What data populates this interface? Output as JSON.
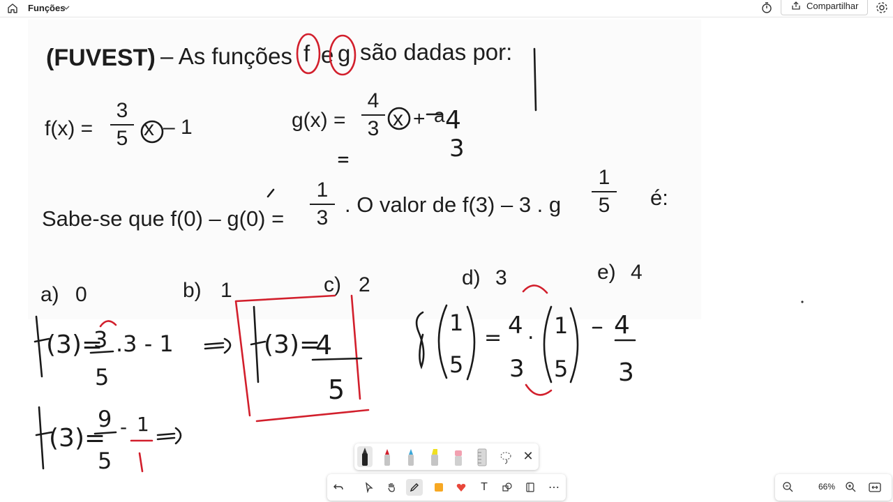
{
  "topbar": {
    "title": "Funções",
    "share_label": "Compartilhar"
  },
  "question": {
    "header": "(FUVEST)",
    "intro": "– As funções",
    "f_letter": "f",
    "e_letter": "e",
    "g_letter": "g",
    "intro_end": "são dadas por:",
    "fx_label": "f(x) =",
    "fx_num": "3",
    "fx_den": "5",
    "fx_var": "x",
    "fx_tail": "– 1",
    "gx_label": "g(x) =",
    "gx_num": "4",
    "gx_den": "3",
    "gx_var": "x",
    "gx_plus": "+",
    "gx_const_num": "a",
    "gx_const_den": "3",
    "cond_text": "Sabe-se que f(0) – g(0) =",
    "cond_num": "1",
    "cond_den": "3",
    "ask_text": ". O valor de f(3) – 3 . g",
    "ask_num": "1",
    "ask_den": "5",
    "ask_end": "é:",
    "options": [
      {
        "letter": "a)",
        "value": "0"
      },
      {
        "letter": "b)",
        "value": "1"
      },
      {
        "letter": "c)",
        "value": "2"
      },
      {
        "letter": "d)",
        "value": "3"
      },
      {
        "letter": "e)",
        "value": "4"
      }
    ]
  },
  "handwriting": {
    "line1": "f(3)= 3/5 .3 - 1",
    "line2": "f(3)= 4/5",
    "line3": "g(1/5)= 4/3 .(1/5) - 4/3",
    "line4": "f(3)= 9/5 - 1/1",
    "arrow1": "=>",
    "arrow2": "=>",
    "gx_written": "4",
    "gx_written_den": "3"
  },
  "pens": {
    "close_glyph": "✕"
  },
  "tools": {
    "text_glyph": "T",
    "more_glyph": "⋯"
  },
  "zoom": {
    "value": "66%"
  },
  "colors": {
    "ink": "#1a1a1a",
    "red": "#d21f2c",
    "paper": "#fbfbfb"
  }
}
